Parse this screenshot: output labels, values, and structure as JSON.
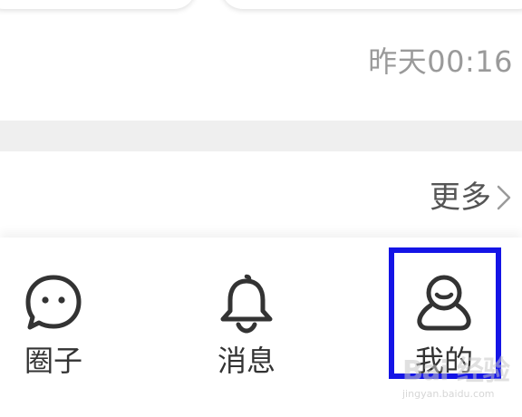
{
  "conversation": {
    "timestamp": "昨天00:16"
  },
  "more": {
    "label": "更多"
  },
  "tabbar": {
    "tabs": [
      {
        "label": "圈子",
        "icon": "chat-bubble-icon"
      },
      {
        "label": "消息",
        "icon": "bell-icon"
      },
      {
        "label": "我的",
        "icon": "user-icon"
      }
    ],
    "highlight_color": "#1414e6"
  },
  "watermark": {
    "main": "Bai 经验",
    "sub": "jingyan.baidu.com"
  }
}
